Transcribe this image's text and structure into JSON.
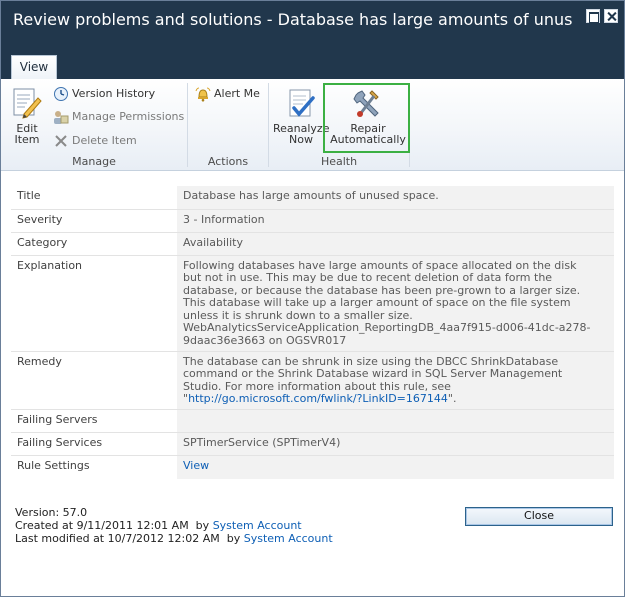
{
  "window": {
    "title": "Review problems and solutions - Database has large amounts of unused space..."
  },
  "tabs": [
    {
      "label": "View"
    }
  ],
  "ribbon": {
    "manage": {
      "label": "Manage",
      "edit_item": [
        "Edit",
        "Item"
      ],
      "version_history": "Version History",
      "manage_permissions": "Manage Permissions",
      "delete_item": "Delete Item"
    },
    "actions": {
      "label": "Actions",
      "alert_me": "Alert Me"
    },
    "health": {
      "label": "Health",
      "reanalyze_now": [
        "Reanalyze",
        "Now"
      ],
      "repair_automatically": [
        "Repair",
        "Automatically"
      ]
    }
  },
  "properties": {
    "title": {
      "key": "Title",
      "value": "Database has large amounts of unused space."
    },
    "severity": {
      "key": "Severity",
      "value": "3 - Information"
    },
    "category": {
      "key": "Category",
      "value": "Availability"
    },
    "explanation": {
      "key": "Explanation",
      "lines": [
        "Following databases have large amounts of space allocated on the disk",
        "but not in use. This may be due to recent deletion of data form the",
        "database, or because the database has been pre-grown to a larger size.",
        "This database will take up a larger amount of space on the file system",
        "unless it is shrunk down to a smaller size.",
        "WebAnalyticsServiceApplication_ReportingDB_4aa7f915-d006-41dc-a278-",
        "9daac36e3663 on OGSVR017"
      ]
    },
    "remedy": {
      "key": "Remedy",
      "lines": [
        "The database can be shrunk in size using the DBCC ShrinkDatabase",
        "command or the Shrink Database wizard in SQL Server Management",
        "Studio. For more information about this rule, see"
      ],
      "link_prefix": "\"",
      "link_text": "http://go.microsoft.com/fwlink/?LinkID=167144",
      "link_suffix": "\"."
    },
    "failing_servers": {
      "key": "Failing Servers",
      "value": ""
    },
    "failing_services": {
      "key": "Failing Services",
      "value": "SPTimerService (SPTimerV4)"
    },
    "rule_settings": {
      "key": "Rule Settings",
      "link_text": "View"
    }
  },
  "footer": {
    "version": "Version: 57.0",
    "created_prefix": "Created at 9/11/2011 12:01 AM  by ",
    "created_by": "System Account",
    "modified_prefix": "Last modified at 10/7/2012 12:02 AM  by ",
    "modified_by": "System Account"
  },
  "buttons": {
    "close": "Close"
  },
  "colors": {
    "title_bar": "#21374c",
    "link": "#0e5fb5",
    "highlight_border": "#3cb043"
  },
  "icons": [
    "maximize-icon",
    "close-icon",
    "edit-item-icon",
    "version-history-icon",
    "manage-permissions-icon",
    "delete-item-icon",
    "alert-me-icon",
    "reanalyze-icon",
    "repair-icon"
  ]
}
